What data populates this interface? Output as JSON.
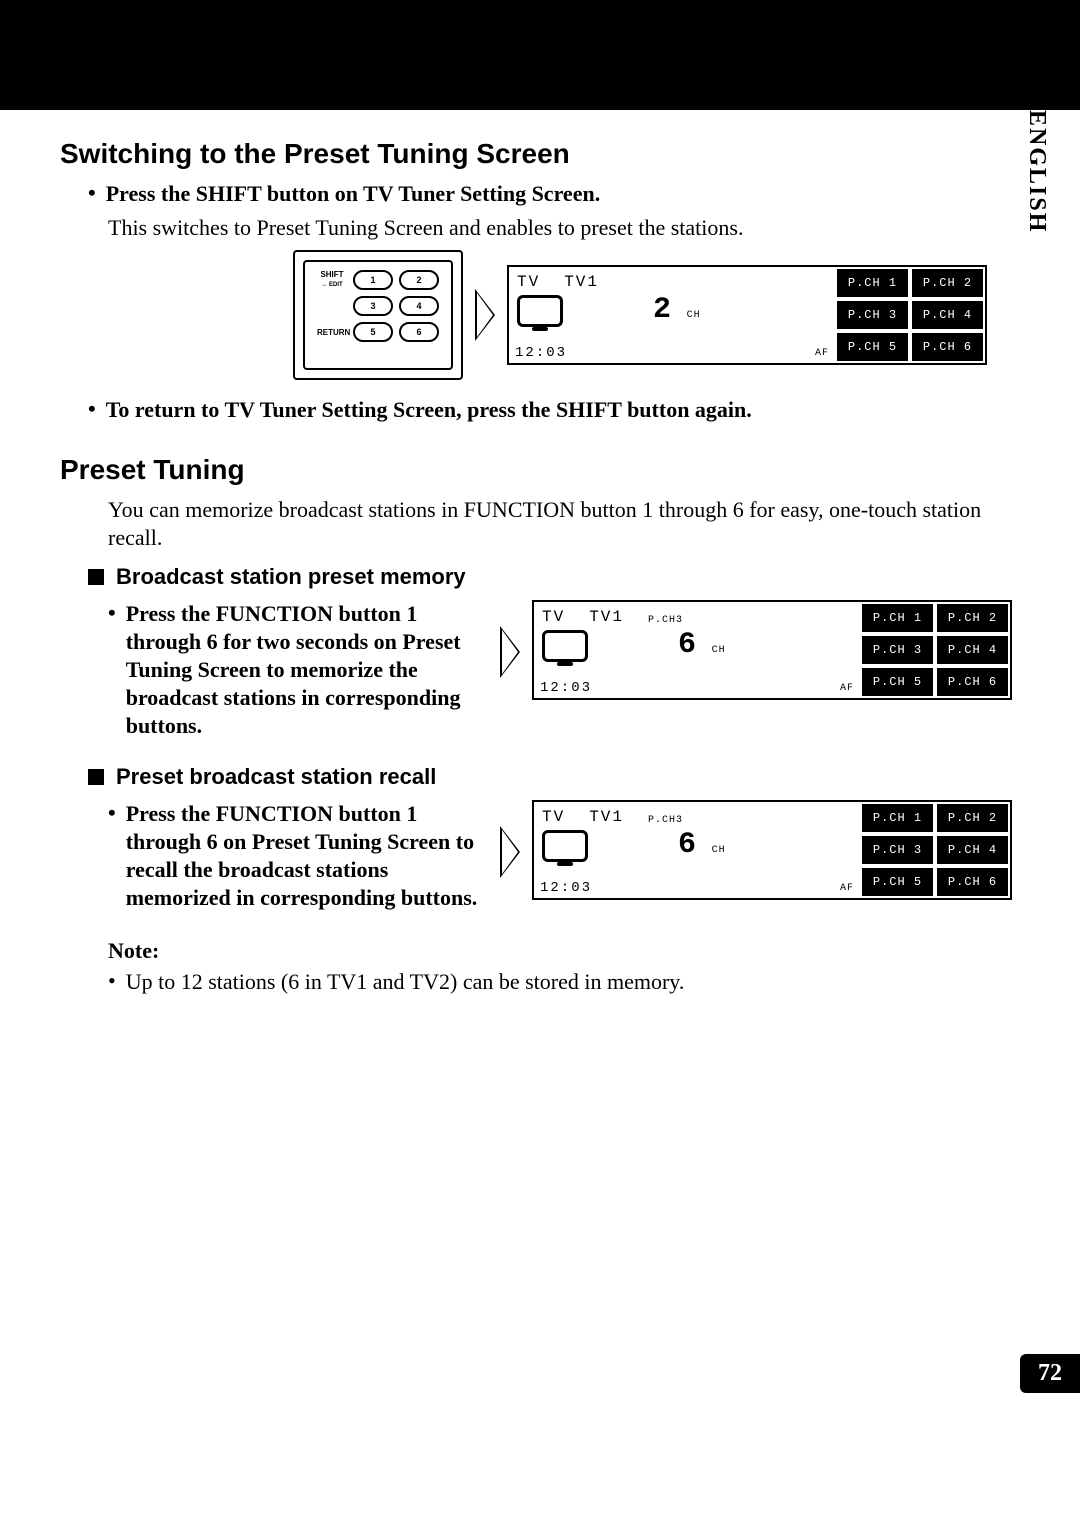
{
  "side_label": "ENGLISH",
  "page_number": "72",
  "sections": {
    "switching": {
      "heading": "Switching to the Preset Tuning Screen",
      "b1": "Press the SHIFT button on TV Tuner Setting Screen.",
      "b1_body": "This switches to Preset Tuning Screen and enables to preset the stations.",
      "b2": "To return to TV Tuner Setting Screen, press the SHIFT button again."
    },
    "preset": {
      "heading": "Preset Tuning",
      "intro": "You can memorize broadcast stations in FUNCTION button 1 through 6 for easy, one-touch station recall.",
      "memory_heading": "Broadcast station preset memory",
      "memory_bullet": "Press the FUNCTION button 1 through 6 for two seconds on Preset Tuning Screen to memorize the broadcast stations in corresponding buttons.",
      "recall_heading": "Preset broadcast station recall",
      "recall_bullet": "Press the FUNCTION button 1 through 6 on Preset Tuning Screen to recall the broadcast stations memorized in corresponding buttons."
    },
    "note": {
      "heading": "Note:",
      "bullet": "Up to 12 stations (6 in TV1  and TV2) can be stored in memory."
    }
  },
  "remote": {
    "shift_label": "SHIFT",
    "shift_sub": "↔ EDIT",
    "return_label": "RETURN",
    "buttons": [
      "1",
      "2",
      "3",
      "4",
      "5",
      "6"
    ]
  },
  "lcd1": {
    "tv": "TV",
    "tv1": "TV1",
    "pch_sub": "",
    "ch_num": "2",
    "ch_label": "CH",
    "time": "12:03",
    "af": "AF",
    "pch": [
      "P.CH 1",
      "P.CH 2",
      "P.CH 3",
      "P.CH 4",
      "P.CH 5",
      "P.CH 6"
    ]
  },
  "lcd2": {
    "tv": "TV",
    "tv1": "TV1",
    "pch_sub": "P.CH3",
    "ch_num": "6",
    "ch_label": "CH",
    "time": "12:03",
    "af": "AF",
    "pch": [
      "P.CH 1",
      "P.CH 2",
      "P.CH 3",
      "P.CH 4",
      "P.CH 5",
      "P.CH 6"
    ]
  },
  "lcd3": {
    "tv": "TV",
    "tv1": "TV1",
    "pch_sub": "P.CH3",
    "ch_num": "6",
    "ch_label": "CH",
    "time": "12:03",
    "af": "AF",
    "pch": [
      "P.CH 1",
      "P.CH 2",
      "P.CH 3",
      "P.CH 4",
      "P.CH 5",
      "P.CH 6"
    ]
  }
}
